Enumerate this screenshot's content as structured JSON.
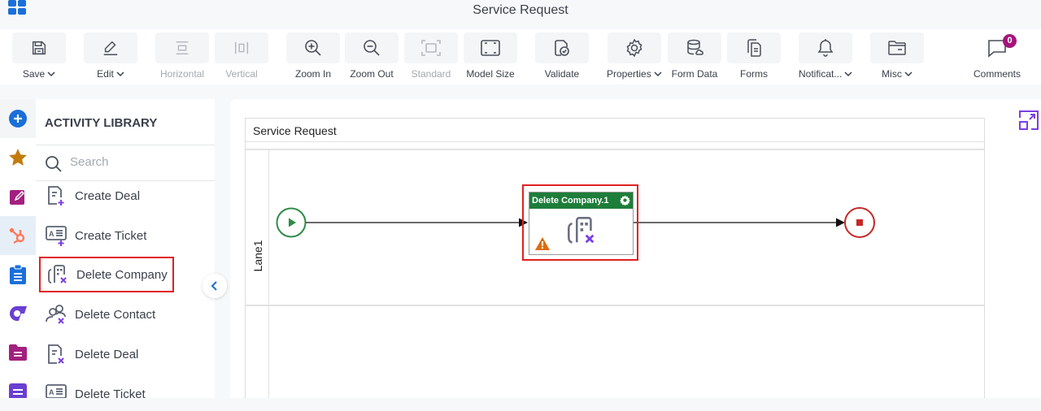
{
  "window": {
    "title": "Service Request"
  },
  "toolbar": {
    "buttons": [
      {
        "id": "save",
        "label": "Save",
        "icon": "save-icon",
        "dropdown": true,
        "enabled": true
      },
      {
        "id": "edit",
        "label": "Edit",
        "icon": "pencil-icon",
        "dropdown": true,
        "enabled": true
      },
      {
        "id": "horizontal",
        "label": "Horizontal",
        "icon": "horizontal-layout-icon",
        "dropdown": false,
        "enabled": false
      },
      {
        "id": "vertical",
        "label": "Vertical",
        "icon": "vertical-layout-icon",
        "dropdown": false,
        "enabled": false
      },
      {
        "id": "zoom-in",
        "label": "Zoom In",
        "icon": "zoom-in-icon",
        "dropdown": false,
        "enabled": true
      },
      {
        "id": "zoom-out",
        "label": "Zoom Out",
        "icon": "zoom-out-icon",
        "dropdown": false,
        "enabled": true
      },
      {
        "id": "standard",
        "label": "Standard",
        "icon": "standard-size-icon",
        "dropdown": false,
        "enabled": false
      },
      {
        "id": "model-size",
        "label": "Model Size",
        "icon": "model-size-icon",
        "dropdown": false,
        "enabled": true
      },
      {
        "id": "validate",
        "label": "Validate",
        "icon": "validate-icon",
        "dropdown": false,
        "enabled": true
      },
      {
        "id": "properties",
        "label": "Properties",
        "icon": "gear-icon",
        "dropdown": true,
        "enabled": true
      },
      {
        "id": "form-data",
        "label": "Form Data",
        "icon": "database-icon",
        "dropdown": false,
        "enabled": true
      },
      {
        "id": "forms",
        "label": "Forms",
        "icon": "forms-icon",
        "dropdown": false,
        "enabled": true
      },
      {
        "id": "notifications",
        "label": "Notificat...",
        "icon": "bell-icon",
        "dropdown": true,
        "enabled": true
      },
      {
        "id": "misc",
        "label": "Misc",
        "icon": "folder-icon",
        "dropdown": true,
        "enabled": true
      }
    ],
    "comments": {
      "label": "Comments",
      "count": "0",
      "badge_color": "#a3157a"
    }
  },
  "left_nav": {
    "items": [
      {
        "name": "add",
        "icon": "plus-circle-icon",
        "color": "#1a6fd9",
        "active": false
      },
      {
        "name": "favorites",
        "icon": "star-icon",
        "color": "#c27c0e",
        "active": false
      },
      {
        "name": "edit-forms",
        "icon": "edit-square-icon",
        "color": "#a3207f",
        "active": false
      },
      {
        "name": "hubspot",
        "icon": "hubspot-icon",
        "color": "#ff7a59",
        "active": true
      },
      {
        "name": "clipboard",
        "icon": "clipboard-icon",
        "color": "#1a6fd9",
        "active": false
      },
      {
        "name": "app-d",
        "icon": "d-logo-icon",
        "color": "#6a3fd1",
        "active": false
      },
      {
        "name": "folder-doc",
        "icon": "folder-doc-icon",
        "color": "#a3207f",
        "active": false
      },
      {
        "name": "list-doc",
        "icon": "list-doc-icon",
        "color": "#6a3fd1",
        "active": false
      }
    ]
  },
  "library": {
    "title": "ACTIVITY LIBRARY",
    "search_placeholder": "Search",
    "items": [
      {
        "label": "Create Deal",
        "icon": "create-deal-icon",
        "selected": false
      },
      {
        "label": "Create Ticket",
        "icon": "create-ticket-icon",
        "selected": false
      },
      {
        "label": "Delete Company",
        "icon": "delete-company-icon",
        "selected": true
      },
      {
        "label": "Delete Contact",
        "icon": "delete-contact-icon",
        "selected": false
      },
      {
        "label": "Delete Deal",
        "icon": "delete-deal-icon",
        "selected": false
      },
      {
        "label": "Delete Ticket",
        "icon": "delete-ticket-icon",
        "selected": false
      }
    ]
  },
  "canvas": {
    "pool_title": "Service Request",
    "lanes": [
      {
        "label": "Lane1"
      }
    ],
    "task": {
      "title": "Delete Company.1",
      "header_color": "#1e7d3a",
      "warning": true
    },
    "start_event_color": "#2e8b47",
    "end_event_color": "#c62828"
  },
  "colors": {
    "accent": "#1a6fd9",
    "selection": "#e02020",
    "icon_purple": "#7b3fe4"
  }
}
